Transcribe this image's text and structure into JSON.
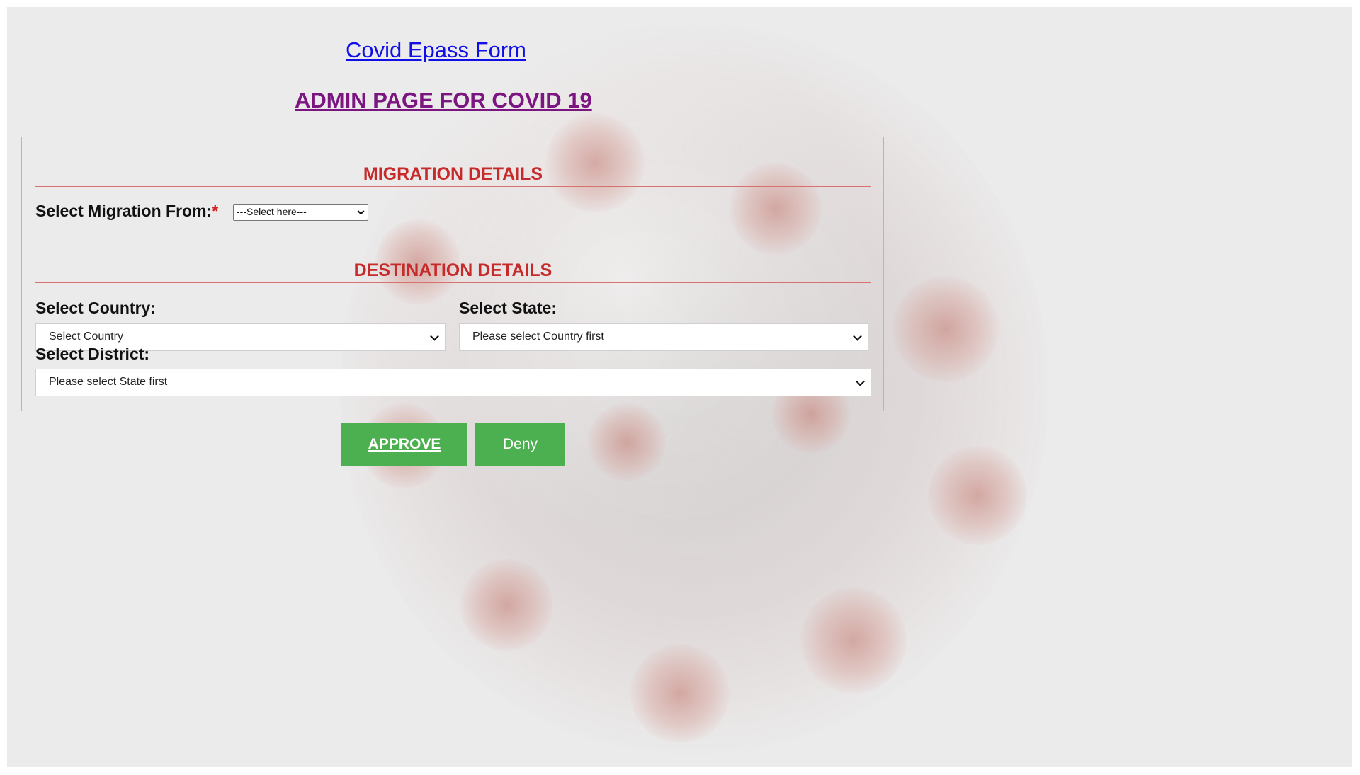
{
  "page": {
    "title": "Covid Epass Form",
    "admin_heading": "ADMIN PAGE FOR COVID 19"
  },
  "migration": {
    "section_title": "MIGRATION DETAILS",
    "from_label": "Select Migration From:",
    "required_mark": "*",
    "from_value": "---Select here---"
  },
  "destination": {
    "section_title": "DESTINATION DETAILS",
    "country_label": "Select Country:",
    "country_value": "Select Country",
    "state_label": "Select State:",
    "state_value": "Please select Country first",
    "district_label": "Select District:",
    "district_value": "Please select State first"
  },
  "actions": {
    "approve_label": "APPROVE",
    "deny_label": "Deny"
  },
  "colors": {
    "title_link": "#0f0fe6",
    "admin_heading": "#7b1580",
    "section_title": "#c62a2a",
    "button_bg": "#4caf50",
    "form_border": "#c9c24a",
    "background": "#ebebeb"
  }
}
